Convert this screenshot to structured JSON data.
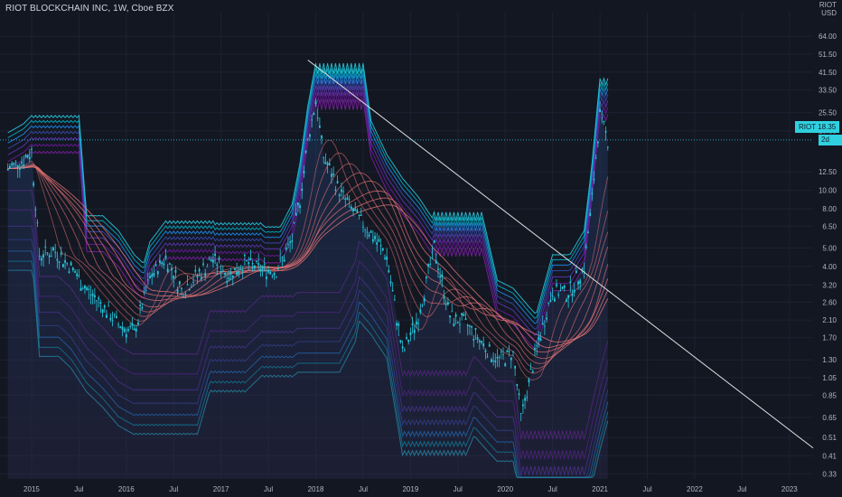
{
  "header": {
    "title": "RIOT BLOCKCHAIN INC, 1W, Cboe BZX",
    "currency_line1": "RIOT",
    "currency_line2": "USD"
  },
  "last_price": {
    "symbol": "RIOT",
    "value": "18.35",
    "countdown": "2d 3h"
  },
  "chart_data": {
    "type": "candlestick",
    "title": "RIOT BLOCKCHAIN INC, 1W, Cboe BZX",
    "xlabel": "",
    "ylabel": "",
    "y_scale": "log",
    "y_ticks": [
      64.0,
      51.5,
      41.5,
      33.5,
      25.5,
      20.5,
      12.5,
      10.0,
      8.0,
      6.5,
      5.0,
      4.0,
      3.2,
      2.6,
      2.1,
      1.7,
      1.3,
      1.05,
      0.85,
      0.65,
      0.51,
      0.41,
      0.33
    ],
    "x_ticks": [
      "2015",
      "Jul",
      "2016",
      "Jul",
      "2017",
      "Jul",
      "2018",
      "Jul",
      "2019",
      "Jul",
      "2020",
      "Jul",
      "2021",
      "Jul",
      "2022",
      "Jul",
      "2023"
    ],
    "x_tick_dates": [
      "2015-01",
      "2015-07",
      "2016-01",
      "2016-07",
      "2017-01",
      "2017-07",
      "2018-01",
      "2018-07",
      "2019-01",
      "2019-07",
      "2020-01",
      "2020-07",
      "2021-01",
      "2021-07",
      "2022-01",
      "2022-07",
      "2023-01"
    ],
    "x_range": [
      "2014-09",
      "2023-04"
    ],
    "y_range": [
      0.31,
      85
    ],
    "last_price": 18.35,
    "price_series": {
      "name": "",
      "x": [
        "2014-10",
        "2014-12",
        "2015-01",
        "2015-02",
        "2015-04",
        "2015-06",
        "2015-08",
        "2015-10",
        "2015-12",
        "2016-02",
        "2016-04",
        "2016-06",
        "2016-08",
        "2016-10",
        "2016-12",
        "2017-02",
        "2017-04",
        "2017-06",
        "2017-08",
        "2017-10",
        "2017-11",
        "2017-12",
        "2018-01",
        "2018-02",
        "2018-04",
        "2018-06",
        "2018-08",
        "2018-10",
        "2018-12",
        "2019-02",
        "2019-04",
        "2019-06",
        "2019-08",
        "2019-10",
        "2019-12",
        "2020-02",
        "2020-03",
        "2020-05",
        "2020-07",
        "2020-09",
        "2020-11",
        "2020-12",
        "2021-01",
        "2021-02"
      ],
      "y": [
        13.0,
        14.5,
        16.0,
        4.6,
        4.8,
        4.0,
        3.0,
        2.5,
        2.0,
        1.8,
        3.5,
        4.5,
        3.0,
        3.6,
        4.4,
        3.6,
        4.2,
        3.9,
        3.8,
        5.5,
        9.0,
        18.0,
        30.0,
        15.0,
        10.0,
        7.5,
        6.0,
        4.5,
        1.4,
        2.2,
        5.0,
        2.2,
        2.0,
        1.6,
        1.3,
        1.4,
        0.65,
        1.5,
        3.0,
        2.9,
        4.0,
        9.0,
        25.0,
        18.35
      ]
    },
    "trendline": {
      "from": {
        "x": "2017-12",
        "y": 48.0
      },
      "to": {
        "x": "2023-04",
        "y": 0.45
      }
    },
    "horizontal_price_line": 18.35,
    "moving_averages_count": 8,
    "bands_count": 7,
    "colors": {
      "background": "#131722",
      "grid": "#1e2230",
      "candle": "#26c6da",
      "bands": [
        "#7b1fa2",
        "#6a1b9a",
        "#5e35b1",
        "#3949ab",
        "#1e88e5",
        "#00acc1",
        "#26c6da"
      ],
      "moving_averages": "#e57373",
      "trendline": "#e0e0e0",
      "axis_text": "#b2b5be",
      "last_price": "#2fd1e0"
    }
  }
}
